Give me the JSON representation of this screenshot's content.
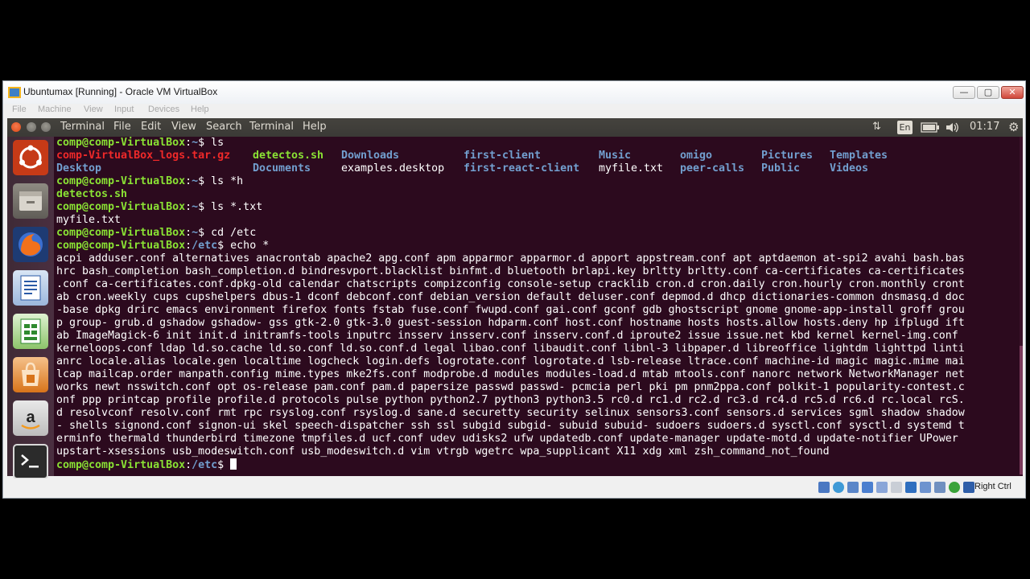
{
  "vbox": {
    "title": "Ubuntumax [Running] - Oracle VM VirtualBox",
    "menu": [
      "File",
      "Machine",
      "View",
      "Input",
      "Devices",
      "Help"
    ],
    "buttons": {
      "minimize": "—",
      "restore": "▢",
      "close": "✕"
    },
    "host_key": "Right Ctrl"
  },
  "ubuntu": {
    "app_name": "Terminal",
    "menu": [
      "File",
      "Edit",
      "View",
      "Search",
      "Terminal",
      "Help"
    ],
    "keyboard_layout": "En",
    "time": "01:17"
  },
  "terminal": {
    "prompt_user": "comp@comp-VirtualBox",
    "home": "~",
    "etc_dir": "/etc",
    "cmd1": "ls",
    "ls_out": [
      [
        "comp-VirtualBox_logs.tar.gz",
        "detectos.sh",
        "Downloads",
        "first-client",
        "Music",
        "omigo",
        "Pictures",
        "Templates"
      ],
      [
        "Desktop",
        "Documents",
        "examples.desktop",
        "first-react-client",
        "myfile.txt",
        "peer-calls",
        "Public",
        "Videos"
      ]
    ],
    "cmd2": "ls *h",
    "out2": "detectos.sh",
    "cmd3": "ls *.txt",
    "out3": "myfile.txt",
    "cmd4": "cd /etc",
    "cmd5": "echo *",
    "echo_lines": [
      "acpi adduser.conf alternatives anacrontab apache2 apg.conf apm apparmor apparmor.d apport appstream.conf apt aptdaemon at-spi2 avahi bash.bas",
      "hrc bash_completion bash_completion.d bindresvport.blacklist binfmt.d bluetooth brlapi.key brltty brltty.conf ca-certificates ca-certificates",
      ".conf ca-certificates.conf.dpkg-old calendar chatscripts compizconfig console-setup cracklib cron.d cron.daily cron.hourly cron.monthly cront",
      "ab cron.weekly cups cupshelpers dbus-1 dconf debconf.conf debian_version default deluser.conf depmod.d dhcp dictionaries-common dnsmasq.d doc",
      "-base dpkg drirc emacs environment firefox fonts fstab fuse.conf fwupd.conf gai.conf gconf gdb ghostscript gnome gnome-app-install groff grou",
      "p group- grub.d gshadow gshadow- gss gtk-2.0 gtk-3.0 guest-session hdparm.conf host.conf hostname hosts hosts.allow hosts.deny hp ifplugd ift",
      "ab ImageMagick-6 init init.d initramfs-tools inputrc insserv insserv.conf insserv.conf.d iproute2 issue issue.net kbd kernel kernel-img.conf",
      "kerneloops.conf ldap ld.so.cache ld.so.conf ld.so.conf.d legal libao.conf libaudit.conf libnl-3 libpaper.d libreoffice lightdm lighttpd linti",
      "anrc locale.alias locale.gen localtime logcheck login.defs logrotate.conf logrotate.d lsb-release ltrace.conf machine-id magic magic.mime mai",
      "lcap mailcap.order manpath.config mime.types mke2fs.conf modprobe.d modules modules-load.d mtab mtools.conf nanorc network NetworkManager net",
      "works newt nsswitch.conf opt os-release pam.conf pam.d papersize passwd passwd- pcmcia perl pki pm pnm2ppa.conf polkit-1 popularity-contest.c",
      "onf ppp printcap profile profile.d protocols pulse python python2.7 python3 python3.5 rc0.d rc1.d rc2.d rc3.d rc4.d rc5.d rc6.d rc.local rcS.",
      "d resolvconf resolv.conf rmt rpc rsyslog.conf rsyslog.d sane.d securetty security selinux sensors3.conf sensors.d services sgml shadow shadow",
      "- shells signond.conf signon-ui skel speech-dispatcher ssh ssl subgid subgid- subuid subuid- sudoers sudoers.d sysctl.conf sysctl.d systemd t",
      "erminfo thermald thunderbird timezone tmpfiles.d ucf.conf udev udisks2 ufw updatedb.conf update-manager update-motd.d update-notifier UPower",
      "upstart-xsessions usb_modeswitch.conf usb_modeswitch.d vim vtrgb wgetrc wpa_supplicant X11 xdg xml zsh_command_not_found"
    ]
  },
  "colors": {
    "terminal_bg": "#2c0a1e",
    "prompt_green": "#8ae234",
    "path_blue": "#729fcf",
    "archive_red": "#ef2929"
  },
  "icons": {
    "launcher": [
      "ubuntu-dash-icon",
      "files-icon",
      "firefox-icon",
      "writer-icon",
      "calc-icon",
      "software-center-icon",
      "amazon-icon",
      "terminal-icon",
      "dvd-icon"
    ],
    "tray": [
      "network-arrows-icon",
      "battery-icon",
      "volume-icon",
      "gear-icon"
    ]
  }
}
